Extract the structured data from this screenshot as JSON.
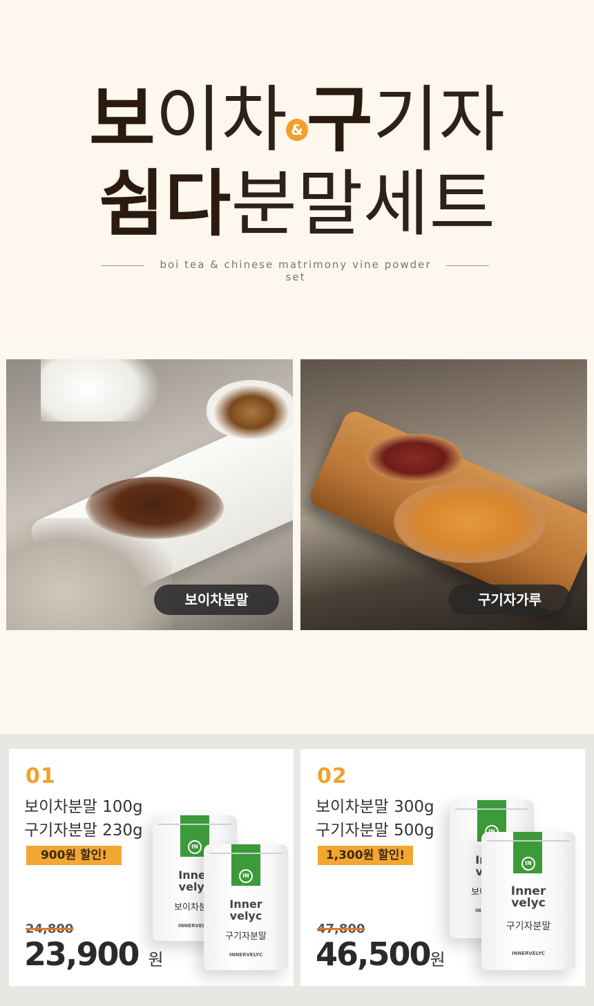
{
  "hero": {
    "title_line1": [
      "보",
      "이차",
      "&",
      "구",
      "기자"
    ],
    "title_line2": [
      "쉼다",
      "분말세트"
    ],
    "subtitle": "boi tea & chinese matrimony vine powder set"
  },
  "photos": [
    {
      "label": "보이차분말"
    },
    {
      "label": "구기자가루"
    }
  ],
  "products": [
    {
      "number": "01",
      "spec1": "보이차분말 100g",
      "spec2": "구기자분말 230g",
      "discount": "900원 할인!",
      "old_price": "24,800",
      "price": "23,900",
      "currency": "원",
      "pouch_back": {
        "brand1": "Inner",
        "brand2": "velyc",
        "name": "보이차분말",
        "logo": "IN",
        "maker": "INNERVELYC"
      },
      "pouch_front": {
        "brand1": "Inner",
        "brand2": "velyc",
        "name": "구기자분말",
        "logo": "IN",
        "maker": "INNERVELYC"
      }
    },
    {
      "number": "02",
      "spec1": "보이차분말 300g",
      "spec2": "구기자분말 500g",
      "discount": "1,300원 할인!",
      "old_price": "47,800",
      "price": "46,500",
      "currency": "원",
      "pouch_back": {
        "brand1": "Inner",
        "brand2": "velyc",
        "name": "보이차분말",
        "logo": "IN",
        "maker": "INNERVELYC"
      },
      "pouch_front": {
        "brand1": "Inner",
        "brand2": "velyc",
        "name": "구기자분말",
        "logo": "IN",
        "maker": "INNERVELYC"
      }
    }
  ],
  "colors": {
    "accent": "#f0a12a",
    "badge": "#f4a633",
    "pouch_green": "#3c9a3a",
    "title": "#2a1a0f"
  }
}
